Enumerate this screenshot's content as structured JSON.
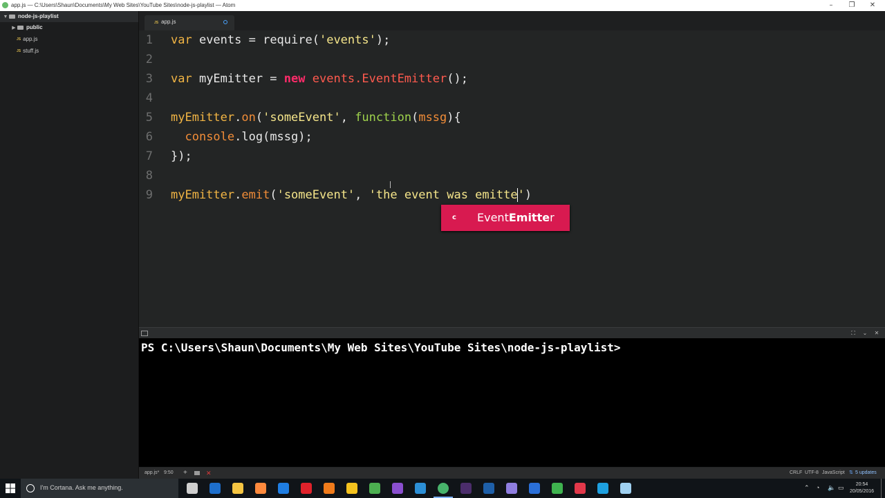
{
  "window": {
    "title": "app.js — C:\\Users\\Shaun\\Documents\\My Web Sites\\YouTube Sites\\node-js-playlist — Atom"
  },
  "tree": {
    "root": "node-js-playlist",
    "items": [
      {
        "label": "public",
        "type": "folder"
      },
      {
        "label": "app.js",
        "type": "file",
        "badge": "JS"
      },
      {
        "label": "stuff.js",
        "type": "file",
        "badge": "JS"
      }
    ]
  },
  "tab": {
    "label": "app.js",
    "badge": "JS"
  },
  "editor": {
    "line_numbers": [
      "1",
      "2",
      "3",
      "4",
      "5",
      "6",
      "7",
      "8",
      "9"
    ],
    "lines": [
      [
        {
          "t": "var",
          "c": "kw"
        },
        {
          "t": " events = ",
          "c": "plain"
        },
        {
          "t": "require(",
          "c": "plain"
        },
        {
          "t": "'events'",
          "c": "str"
        },
        {
          "t": ");",
          "c": "plain"
        }
      ],
      [],
      [
        {
          "t": "var",
          "c": "kw"
        },
        {
          "t": " myEmitter = ",
          "c": "plain"
        },
        {
          "t": "new",
          "c": "new"
        },
        {
          "t": " ",
          "c": "plain"
        },
        {
          "t": "events.EventEmitter",
          "c": "cls"
        },
        {
          "t": "();",
          "c": "plain"
        }
      ],
      [],
      [
        {
          "t": "myEmitter",
          "c": "var"
        },
        {
          "t": ".",
          "c": "plain"
        },
        {
          "t": "on",
          "c": "fn"
        },
        {
          "t": "(",
          "c": "plain"
        },
        {
          "t": "'someEvent'",
          "c": "str"
        },
        {
          "t": ", ",
          "c": "plain"
        },
        {
          "t": "function",
          "c": "func"
        },
        {
          "t": "(",
          "c": "plain"
        },
        {
          "t": "mssg",
          "c": "param"
        },
        {
          "t": "){",
          "c": "plain"
        }
      ],
      [
        {
          "t": "  ",
          "c": "plain"
        },
        {
          "t": "console",
          "c": "fn"
        },
        {
          "t": ".log(mssg);",
          "c": "plain"
        }
      ],
      [
        {
          "t": "});",
          "c": "plain"
        }
      ],
      [],
      [
        {
          "t": "myEmitter",
          "c": "var"
        },
        {
          "t": ".",
          "c": "plain"
        },
        {
          "t": "emit",
          "c": "fn"
        },
        {
          "t": "(",
          "c": "plain"
        },
        {
          "t": "'someEvent'",
          "c": "str"
        },
        {
          "t": ", ",
          "c": "plain"
        },
        {
          "t": "'the event was emitte",
          "c": "str"
        },
        {
          "t": "CURSOR",
          "c": "cursor"
        },
        {
          "t": "'",
          "c": "str"
        },
        {
          "t": ")",
          "c": "plain"
        }
      ]
    ]
  },
  "autocomplete": {
    "kind": "c",
    "prefix": "Event",
    "match": "Emitte",
    "suffix": "r"
  },
  "terminal": {
    "prompt": "PS C:\\Users\\Shaun\\Documents\\My Web Sites\\YouTube Sites\\node-js-playlist>"
  },
  "status": {
    "file": "app.js*",
    "position": "9:50",
    "line_ending": "CRLF",
    "encoding": "UTF-8",
    "grammar": "JavaScript",
    "updates": "5 updates"
  },
  "taskbar": {
    "search_placeholder": "I'm Cortana. Ask me anything.",
    "time": "20:54",
    "date": "20/05/2016",
    "apps": [
      {
        "name": "task-view-icon",
        "color": "#cfcfcf"
      },
      {
        "name": "outlook-icon",
        "color": "#1e6fcc"
      },
      {
        "name": "file-explorer-icon",
        "color": "#f5c542"
      },
      {
        "name": "store-icon",
        "color": "#ff8a3d"
      },
      {
        "name": "edge-icon",
        "color": "#1f7ee3"
      },
      {
        "name": "opera-icon",
        "color": "#e0222b"
      },
      {
        "name": "firefox-icon",
        "color": "#f07b1b"
      },
      {
        "name": "app-yellow-icon",
        "color": "#f4c21e"
      },
      {
        "name": "chrome-icon",
        "color": "#4caf50"
      },
      {
        "name": "visual-studio-icon",
        "color": "#8a4fcf"
      },
      {
        "name": "app-blue-icon",
        "color": "#2c8fd6"
      },
      {
        "name": "atom-icon",
        "color": "#48b36b"
      },
      {
        "name": "premiere-icon",
        "color": "#4b2d6b"
      },
      {
        "name": "photoshop-icon",
        "color": "#1e5fa8"
      },
      {
        "name": "app-circle-icon",
        "color": "#8f7ee0"
      },
      {
        "name": "media-player-icon",
        "color": "#2a6fd8"
      },
      {
        "name": "security-icon",
        "color": "#3fb34f"
      },
      {
        "name": "app-red-icon",
        "color": "#e2384a"
      },
      {
        "name": "skype-icon",
        "color": "#1ea0e0"
      },
      {
        "name": "notepad-icon",
        "color": "#9fd0f0"
      }
    ]
  }
}
